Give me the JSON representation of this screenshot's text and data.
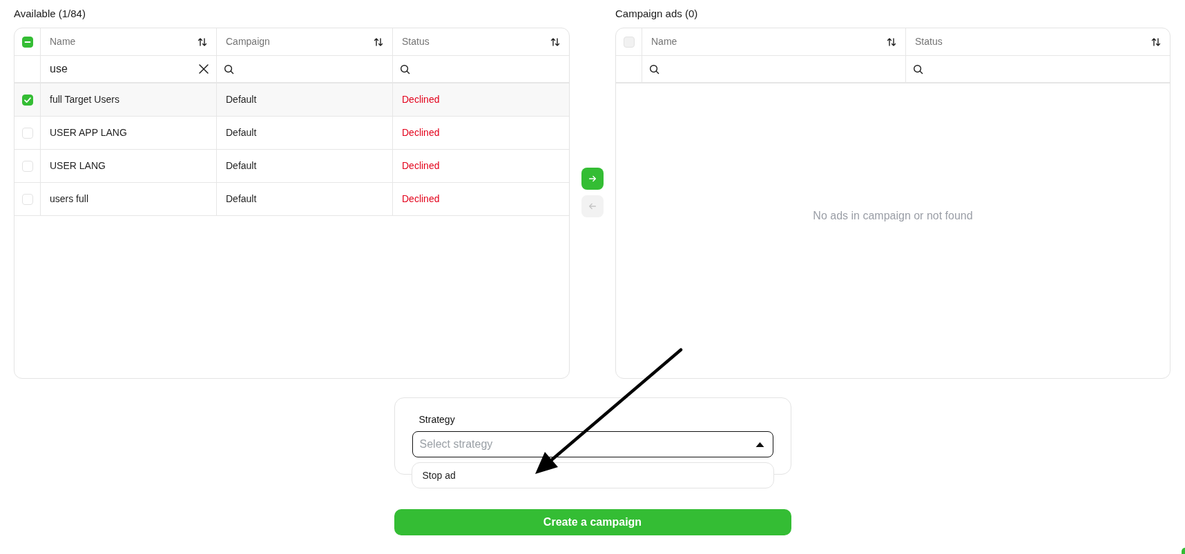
{
  "available": {
    "title": "Available (1/84)",
    "select_all": {
      "checked": true,
      "partial": true
    },
    "columns": [
      {
        "label": "Name",
        "kind": "text",
        "filter": "use"
      },
      {
        "label": "Campaign",
        "kind": "text"
      },
      {
        "label": "Status",
        "kind": "status"
      }
    ],
    "rows": [
      {
        "checked": true,
        "cells": [
          "full Target Users",
          "Default",
          "Declined"
        ]
      },
      {
        "checked": false,
        "cells": [
          "USER APP LANG",
          "Default",
          "Declined"
        ]
      },
      {
        "checked": false,
        "cells": [
          "USER LANG",
          "Default",
          "Declined"
        ]
      },
      {
        "checked": false,
        "cells": [
          "users full",
          "Default",
          "Declined"
        ]
      }
    ]
  },
  "transfer_buttons": [
    {
      "kind": "add",
      "disabled": false
    },
    {
      "kind": "remove",
      "disabled": true
    }
  ],
  "campaign_ads": {
    "title": "Campaign ads (0)",
    "select_all": {
      "checked": false,
      "disabled": true
    },
    "columns": [
      {
        "label": "Name"
      },
      {
        "label": "Status"
      }
    ],
    "empty_message": "No ads in campaign or not found"
  },
  "strategy": {
    "label": "Strategy",
    "placeholder": "Select strategy",
    "expanded": true,
    "options": [
      {
        "label": "Stop ad",
        "selected": false
      }
    ]
  },
  "submit_button": {
    "label": "Create a campaign"
  }
}
